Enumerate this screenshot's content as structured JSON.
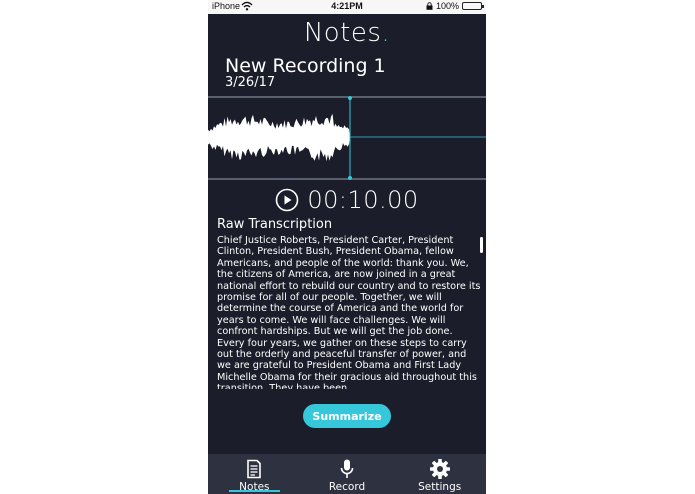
{
  "status_bar": {
    "carrier": "iPhone",
    "time": "4:21PM",
    "battery": "100%",
    "battery_level": 1.0
  },
  "app": {
    "title": "Notes",
    "title_dot": ".",
    "accent_color": "#36c8da",
    "background_color": "#1b1e2a"
  },
  "recording": {
    "title": "New Recording 1",
    "date": "3/26/17",
    "timecode": "00:10.00",
    "playback_progress": 0.51
  },
  "transcription": {
    "heading": "Raw Transcription",
    "text": "Chief Justice Roberts, President Carter, President Clinton, President Bush, President Obama, fellow Americans, and people of the world: thank you. We, the citizens of America, are now joined in a great national effort to rebuild our country and to restore its promise for all of our people. Together, we will determine the course of America and the world for years to come. We will face challenges. We will confront hardships. But we will get the job done. Every four years, we gather on these steps to carry out the orderly and peaceful transfer of power, and we are grateful to President Obama and First Lady Michelle Obama for their gracious aid throughout this transition. They have been"
  },
  "actions": {
    "summarize_label": "Summarize"
  },
  "tabs": [
    {
      "label": "Notes",
      "icon": "document-icon",
      "active": true
    },
    {
      "label": "Record",
      "icon": "microphone-icon",
      "active": false
    },
    {
      "label": "Settings",
      "icon": "gear-icon",
      "active": false
    }
  ]
}
